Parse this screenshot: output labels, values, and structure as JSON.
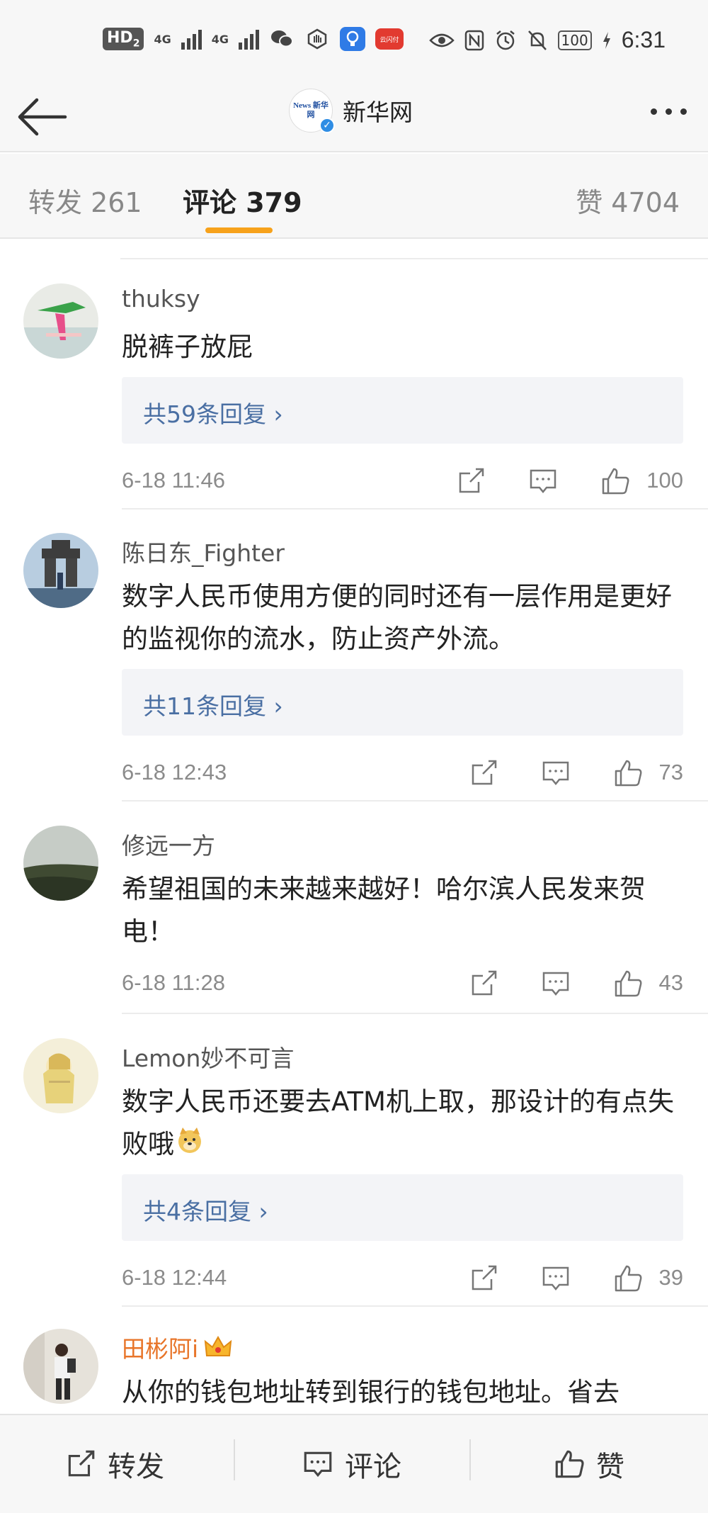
{
  "status_bar": {
    "network_hd": "HD",
    "hd_sub": "2",
    "network_1": "4G",
    "network_2": "4G",
    "pay_badge": "云闪付",
    "battery": "100",
    "time": "6:31"
  },
  "header": {
    "account_name": "新华网",
    "account_logo_text": "News 新华网"
  },
  "tabs": {
    "repost": "转发 261",
    "comments": "评论 379",
    "likes": "赞 4704",
    "active_color": "#f7a21b"
  },
  "comments": [
    {
      "username": "thuksy",
      "text": "脱裤子放屁",
      "replies": "共59条回复 ›",
      "time": "6-18 11:46",
      "likes": "100"
    },
    {
      "username": "陈日东_Fighter",
      "text": "数字人民币使用方便的同时还有一层作用是更好的监视你的流水，防止资产外流。",
      "replies": "共11条回复 ›",
      "time": "6-18 12:43",
      "likes": "73"
    },
    {
      "username": "修远一方",
      "text": "希望祖国的未来越来越好！哈尔滨人民发来贺电！",
      "replies": "",
      "time": "6-18 11:28",
      "likes": "43"
    },
    {
      "username": "Lemon妙不可言",
      "text": "数字人民币还要去ATM机上取，那设计的有点失败哦",
      "replies": "共4条回复 ›",
      "time": "6-18 12:44",
      "likes": "39"
    },
    {
      "username": "田彬阿i",
      "text": "从你的钱包地址转到银行的钱包地址。省去",
      "replies": "",
      "time": "",
      "likes": ""
    }
  ],
  "bottom_bar": {
    "repost": "转发",
    "comment": "评论",
    "like": "赞"
  },
  "colors": {
    "reply_link": "#4a6fa3",
    "vip_name": "#e8752a",
    "verified_badge": "#2f8de4"
  },
  "icons": [
    "back-arrow-icon",
    "more-icon",
    "repost-icon",
    "comment-icon",
    "like-icon",
    "chevron-right-icon",
    "crown-icon",
    "doge-emoji-icon",
    "verified-icon"
  ]
}
